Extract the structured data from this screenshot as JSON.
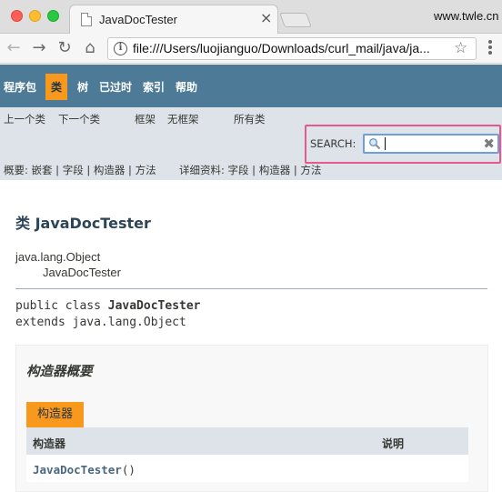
{
  "browser": {
    "tab_title": "JavaDocTester",
    "tab_close": "×",
    "brand": "www.twle.cn",
    "url": "file:///Users/luojianguo/Downloads/curl_mail/java/ja...",
    "icons": [
      "back-icon",
      "forward-icon",
      "reload-icon",
      "home-icon",
      "info-icon",
      "star-icon",
      "menu-icon"
    ]
  },
  "topnav": {
    "items": [
      "程序包",
      "类",
      "树",
      "已过时",
      "索引",
      "帮助"
    ],
    "active": "类",
    "background": "#4d7a97",
    "active_color": "#f8981d"
  },
  "subnav": {
    "prev_class": "上一个类",
    "next_class": "下一个类",
    "frames": "框架",
    "no_frames": "无框架",
    "all_classes": "所有类",
    "search_label": "SEARCH:",
    "search_value": "",
    "summary_label": "概要: 嵌套 | 字段 | 构造器 | 方法",
    "detail_label": "详细资料: 字段 | 构造器 | 方法"
  },
  "content": {
    "class_title": "类 JavaDocTester",
    "inheritance_parent": "java.lang.Object",
    "inheritance_child": "JavaDocTester",
    "signature_line1_prefix": "public class ",
    "signature_line1_name": "JavaDocTester",
    "signature_line2": "extends java.lang.Object",
    "summary_heading": "构造器概要",
    "caption": "构造器",
    "col_constructor": "构造器",
    "col_description": "说明",
    "row_constructor_name": "JavaDocTester",
    "row_constructor_params": "()"
  }
}
